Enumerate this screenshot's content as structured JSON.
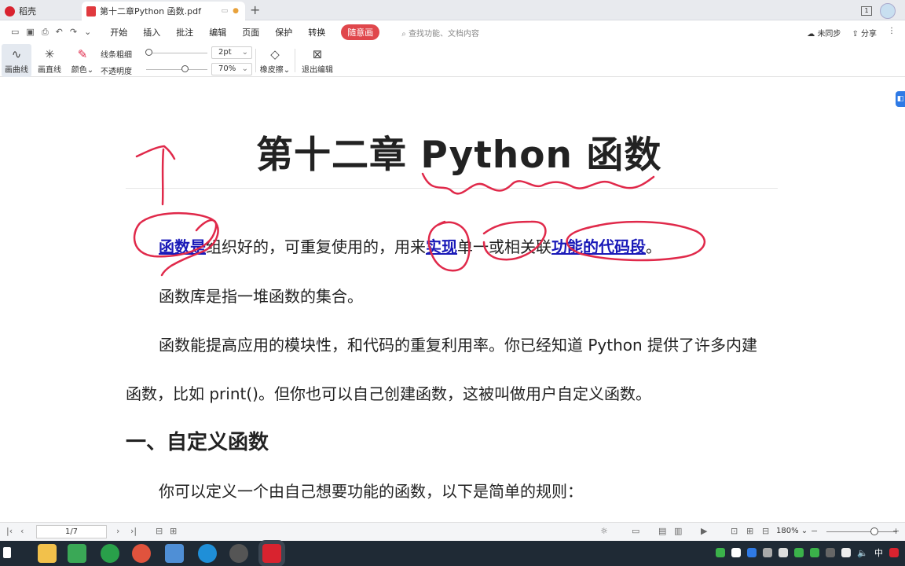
{
  "tabs": {
    "home": "稻壳",
    "document": "第十二章Python 函数.pdf"
  },
  "menu": {
    "items": [
      "开始",
      "插入",
      "批注",
      "编辑",
      "页面",
      "保护",
      "转换"
    ],
    "active": "随意画",
    "search_placeholder": "查找功能、文档内容",
    "sync": "未同步",
    "share": "分享"
  },
  "ribbon": {
    "curve": "画曲线",
    "line": "画直线",
    "color": "颜色",
    "thickness_label": "线条粗细",
    "opacity_label": "不透明度",
    "thickness_value": "2pt",
    "opacity_value": "70%",
    "eraser": "橡皮擦",
    "exit": "退出编辑"
  },
  "document": {
    "title": "第十二章  Python  函数",
    "p1_hl1": "函数是",
    "p1_a": "组织好的，可重复使用的，用来",
    "p1_hl2": "实现",
    "p1_b": "单一或相关联",
    "p1_hl3": "功能的代码段",
    "p1_end": "。",
    "p2": "函数库是指一堆函数的集合。",
    "p3a": "函数能提高应用的模块性，和代码的重复利用率。你已经知道 Python 提供了许多内建",
    "p3b": "函数，比如 print()。但你也可以自己创建函数，这被叫做用户自定义函数。",
    "h2": "一、自定义函数",
    "p4": "你可以定义一个由自己想要功能的函数，以下是简单的规则："
  },
  "status": {
    "page": "1/7",
    "zoom": "180%"
  },
  "taskbar": {
    "ime": "中"
  },
  "colors": {
    "ink": "#e0294a",
    "highlight": "#1a1ab8",
    "accent": "#e0474c"
  }
}
